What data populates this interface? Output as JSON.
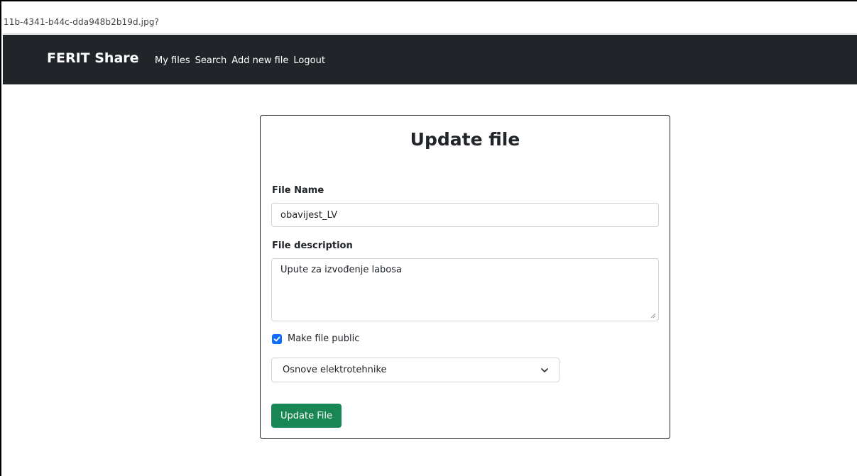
{
  "browser": {
    "url": "11b-4341-b44c-dda948b2b19d.jpg?"
  },
  "navbar": {
    "brand": "FERIT Share",
    "links": [
      "My files",
      "Search",
      "Add new file",
      "Logout"
    ]
  },
  "form": {
    "title": "Update file",
    "file_name_label": "File Name",
    "file_name_value": "obavijest_LV",
    "description_label": "File description",
    "description_value": "Upute za izvođenje labosa",
    "public_label": "Make file public",
    "public_checked": true,
    "subject_selected": "Osnove elektrotehnike",
    "submit_label": "Update File"
  },
  "colors": {
    "navbar_bg": "#212529",
    "checkbox_accent": "#0d6efd",
    "submit_bg": "#198754"
  }
}
